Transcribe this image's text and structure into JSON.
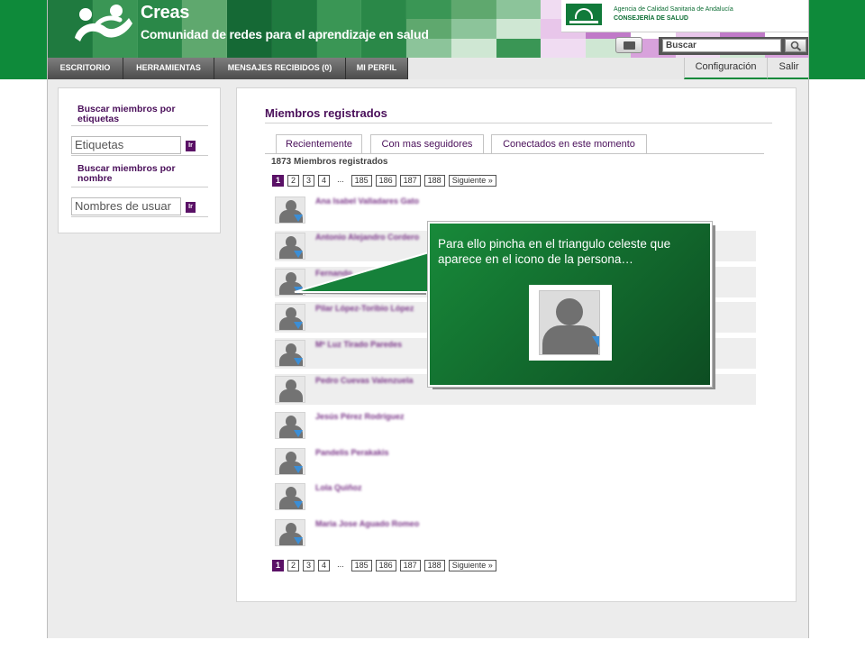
{
  "header": {
    "title": "Creas",
    "subtitle": "Comunidad de redes para el aprendizaje en salud",
    "agency_line1": "Agencia de Calidad Sanitaria de Andalucía",
    "agency_line2": "CONSEJERÍA DE SALUD",
    "emblem_text": "JUNTA DE ANDALUCÍA"
  },
  "search": {
    "placeholder": "Buscar"
  },
  "nav": {
    "items": [
      "ESCRITORIO",
      "HERRAMIENTAS",
      "MENSAJES RECIBIDOS (0)",
      "MI PERFIL"
    ],
    "right": [
      "Configuración",
      "Salir"
    ]
  },
  "sidebar": {
    "tags_label": "Buscar miembros por etiquetas",
    "tags_placeholder": "Etiquetas",
    "name_label": "Buscar miembros por nombre",
    "name_placeholder": "Nombres de usuar",
    "go_label": "Ir"
  },
  "main": {
    "title": "Miembros registrados",
    "tabs": [
      "Recientemente",
      "Con mas seguidores",
      "Conectados en este momento"
    ],
    "count": "1873 Miembros registrados",
    "pagination": [
      "1",
      "2",
      "3",
      "4",
      "...",
      "185",
      "186",
      "187",
      "188",
      "Siguiente »"
    ],
    "members": [
      "Ana Isabel Valladares Gato",
      "Antonio Alejandro Cordero",
      "Fernando",
      "Pilar López-Toribio López",
      "Mª Luz Tirado Paredes",
      "Pedro Cuevas Valenzuela",
      "Jesús Pérez Rodríguez",
      "Pandelis Perakakis",
      "Lola Quiñoz",
      "Maria Jose Aguado Romeo"
    ]
  },
  "callout": {
    "text": "Para ello pincha en el triangulo celeste que aparece en el icono de la persona…",
    "accent": "#3b8ed6"
  },
  "colors": {
    "brand_green": "#0e8a3a",
    "brand_purple": "#5a1166"
  }
}
